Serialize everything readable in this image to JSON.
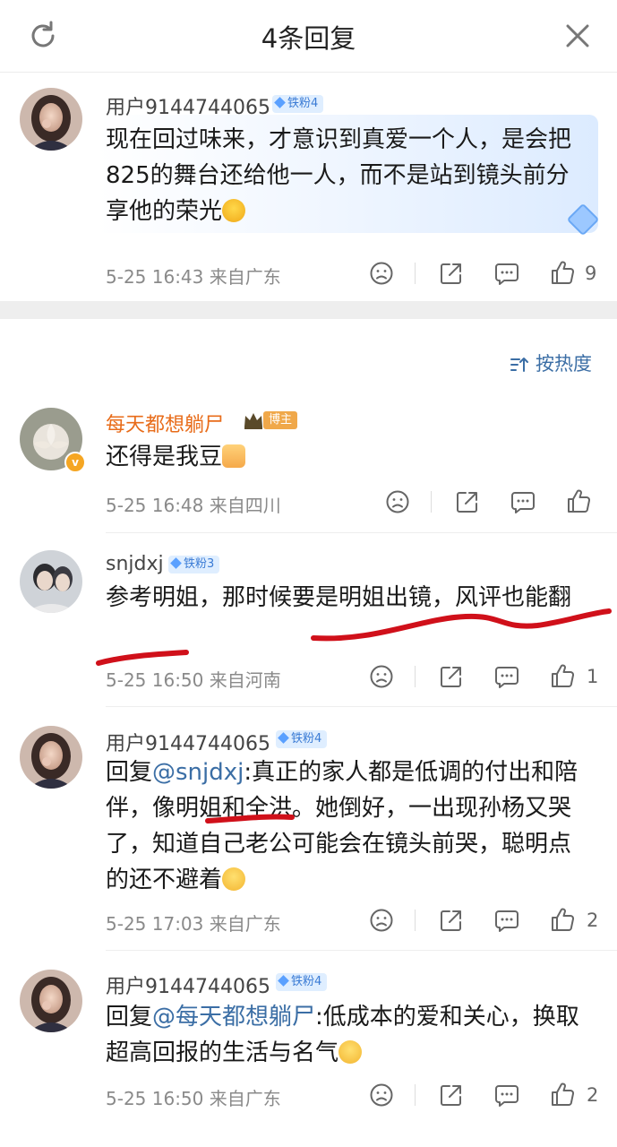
{
  "header": {
    "title": "4条回复"
  },
  "root_comment": {
    "username": "用户9144744065",
    "fan_badge": "铁粉4",
    "text": "现在回过味来，才意识到真爱一个人，是会把825的舞台还给他一人，而不是站到镜头前分享他的荣光",
    "meta": "5-25 16:43  来自广东",
    "likes": "9"
  },
  "sort": {
    "label": "按热度"
  },
  "replies": [
    {
      "username": "每天都想躺尸",
      "role_badge": "博主",
      "text": "还得是我豆",
      "meta": "5-25 16:48  来自四川",
      "likes": ""
    },
    {
      "username": "snjdxj",
      "fan_badge": "铁粉3",
      "text": "参考明姐，那时候要是明姐出镜，风评也能翻",
      "meta": "5-25 16:50  来自河南",
      "likes": "1"
    },
    {
      "username": "用户9144744065",
      "fan_badge": "铁粉4",
      "reply_prefix": "回复",
      "mention": "@snjdxj",
      "text": ":真正的家人都是低调的付出和陪伴，像明姐和全洪。她倒好，一出现孙杨又哭了，知道自己老公可能会在镜头前哭，聪明点的还不避着",
      "meta": "5-25 17:03  来自广东",
      "likes": "2"
    },
    {
      "username": "用户9144744065",
      "fan_badge": "铁粉4",
      "reply_prefix": "回复",
      "mention": "@每天都想躺尸",
      "text": ":低成本的爱和关心，换取超高回报的生活与名气",
      "meta": "5-25 16:50  来自广东",
      "likes": "2"
    }
  ],
  "icons": {
    "refresh": "refresh-icon",
    "close": "close-icon",
    "dislike": "frown-icon",
    "share": "share-icon",
    "comment": "comment-icon",
    "like": "thumb-up-icon"
  },
  "colors": {
    "accent": "#3b6ea5",
    "blogger": "#e86c1a",
    "annotation": "#d0101a"
  }
}
